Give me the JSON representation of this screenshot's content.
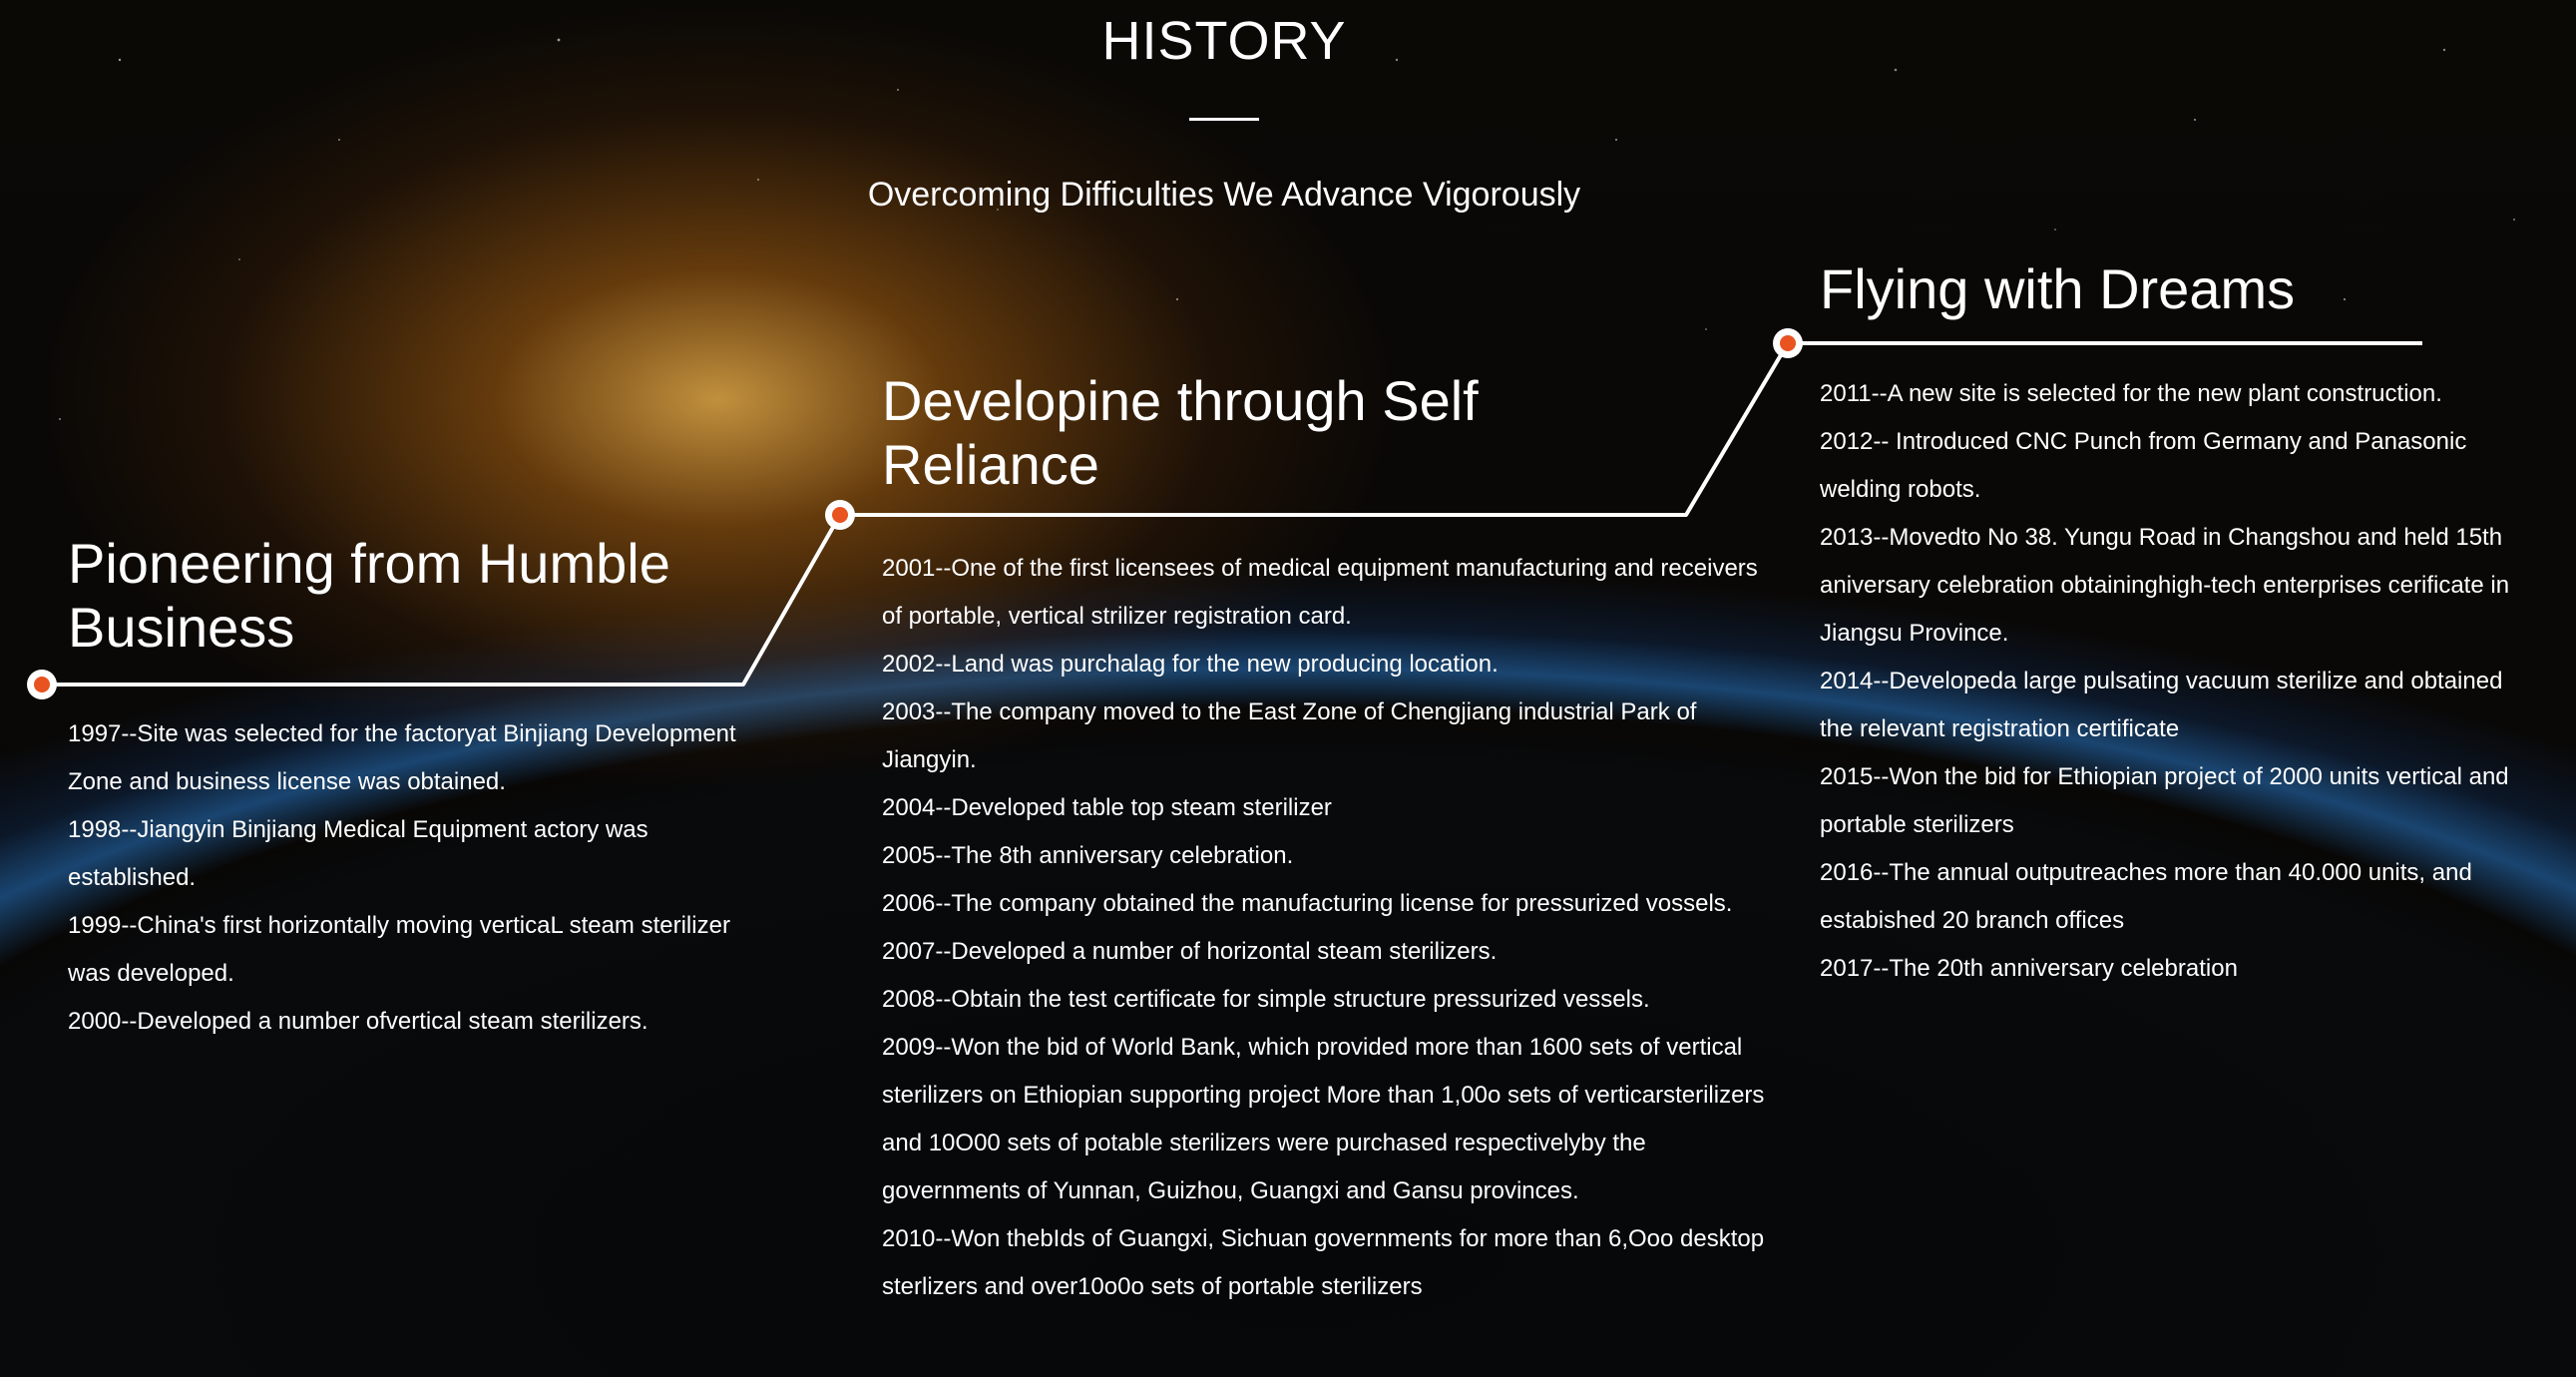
{
  "header": {
    "title": "HISTORY",
    "subtitle": "Overcoming Difficulties We Advance Vigorously"
  },
  "colors": {
    "accent": "#e8531f",
    "line": "#ffffff",
    "text": "#ffffff"
  },
  "sections": [
    {
      "heading": "Pioneering from Humble Business",
      "entries": [
        "1997--Site was selected for the factoryat Binjiang Development Zone and business license was obtained.",
        "1998--Jiangyin Binjiang Medical Equipment actory was established.",
        "1999--China's first horizontally moving verticaL steam sterilizer was developed.",
        "2000--Developed a number ofvertical steam sterilizers."
      ]
    },
    {
      "heading": "Developine through Self Reliance",
      "entries": [
        "2001--One of the first licensees of medical equipment manufacturing and receivers of portable, vertical strilizer registration card.",
        "2002--Land was purchalag for the new producing location.",
        "2003--The company moved to the East Zone of Chengjiang industrial Park of Jiangyin.",
        "2004--Developed table top steam sterilizer",
        "2005--The 8th anniversary celebration.",
        "2006--The company obtained the manufacturing license for pressurized vossels.",
        "2007--Developed a number of horizontal steam sterilizers.",
        "2008--Obtain the test certificate for simple structure pressurized vessels.",
        "2009--Won the bid of World Bank, which provided more than 1600 sets of vertical sterilizers on Ethiopian supporting project More than 1,00o sets of verticarsterilizers and 10O00 sets of potable sterilizers were purchased respectivelyby the governments of Yunnan, Guizhou, Guangxi and Gansu provinces.",
        "2010--Won thebIds of Guangxi, Sichuan governments for more than 6,Ooo desktop sterlizers and over10o0o sets of portable sterilizers"
      ]
    },
    {
      "heading": "Flying with Dreams",
      "entries": [
        "2011--A new site is selected for the new plant construction.",
        "2012-- Introduced CNC Punch from Germany and Panasonic welding robots.",
        "2013--Movedto No 38. Yungu Road in Changshou and held 15th aniversary celebration obtaininghigh-tech enterprises cerificate in Jiangsu Province.",
        "2014--Developeda large pulsating vacuum sterilize and obtained the relevant registration certificate",
        "2015--Won the bid for Ethiopian project of 2000 units vertical and portable sterilizers",
        "2016--The annual outputreaches more than 40.000 units, and estabished 20 branch offices",
        "2017--The 20th anniversary celebration"
      ]
    }
  ]
}
